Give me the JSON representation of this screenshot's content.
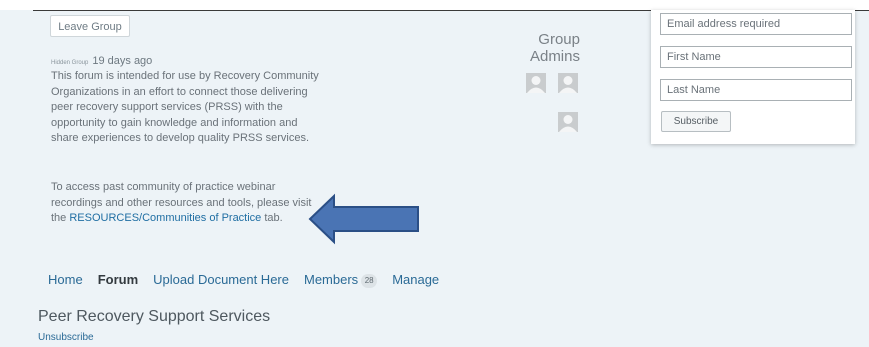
{
  "group": {
    "leave_button": "Leave Group",
    "visibility_tag": "Hidden Group",
    "age": "19 days ago",
    "description": "This forum is intended for use by Recovery Community Organizations in an effort to connect those delivering peer recovery support services (PRSS) with the opportunity to gain knowledge and information and share experiences to develop quality PRSS services.",
    "access_text_before": "To access past community of practice webinar recordings and other resources and tools, please visit the ",
    "access_link": "RESOURCES/Communities of Practice",
    "access_text_after": " tab."
  },
  "admins": {
    "title": "Group Admins"
  },
  "signup_form": {
    "email_placeholder": "Email address required",
    "first_name_placeholder": "First Name",
    "last_name_placeholder": "Last Name",
    "subscribe_label": "Subscribe"
  },
  "nav": {
    "tabs": [
      {
        "label": "Home"
      },
      {
        "label": "Forum"
      },
      {
        "label": "Upload Document Here"
      },
      {
        "label": "Members"
      },
      {
        "label": "Manage"
      }
    ],
    "members_count": "28",
    "active_tab": "Forum"
  },
  "forum": {
    "title": "Peer Recovery Support Services",
    "unsubscribe": "Unsubscribe"
  },
  "colors": {
    "page_background": "#edf3f7",
    "link": "#2a6a96",
    "arrow_fill": "#4a74b4",
    "arrow_stroke": "#2b4f86"
  },
  "icons": {
    "avatar": "user-silhouette-icon",
    "arrow": "left-arrow-annotation"
  }
}
